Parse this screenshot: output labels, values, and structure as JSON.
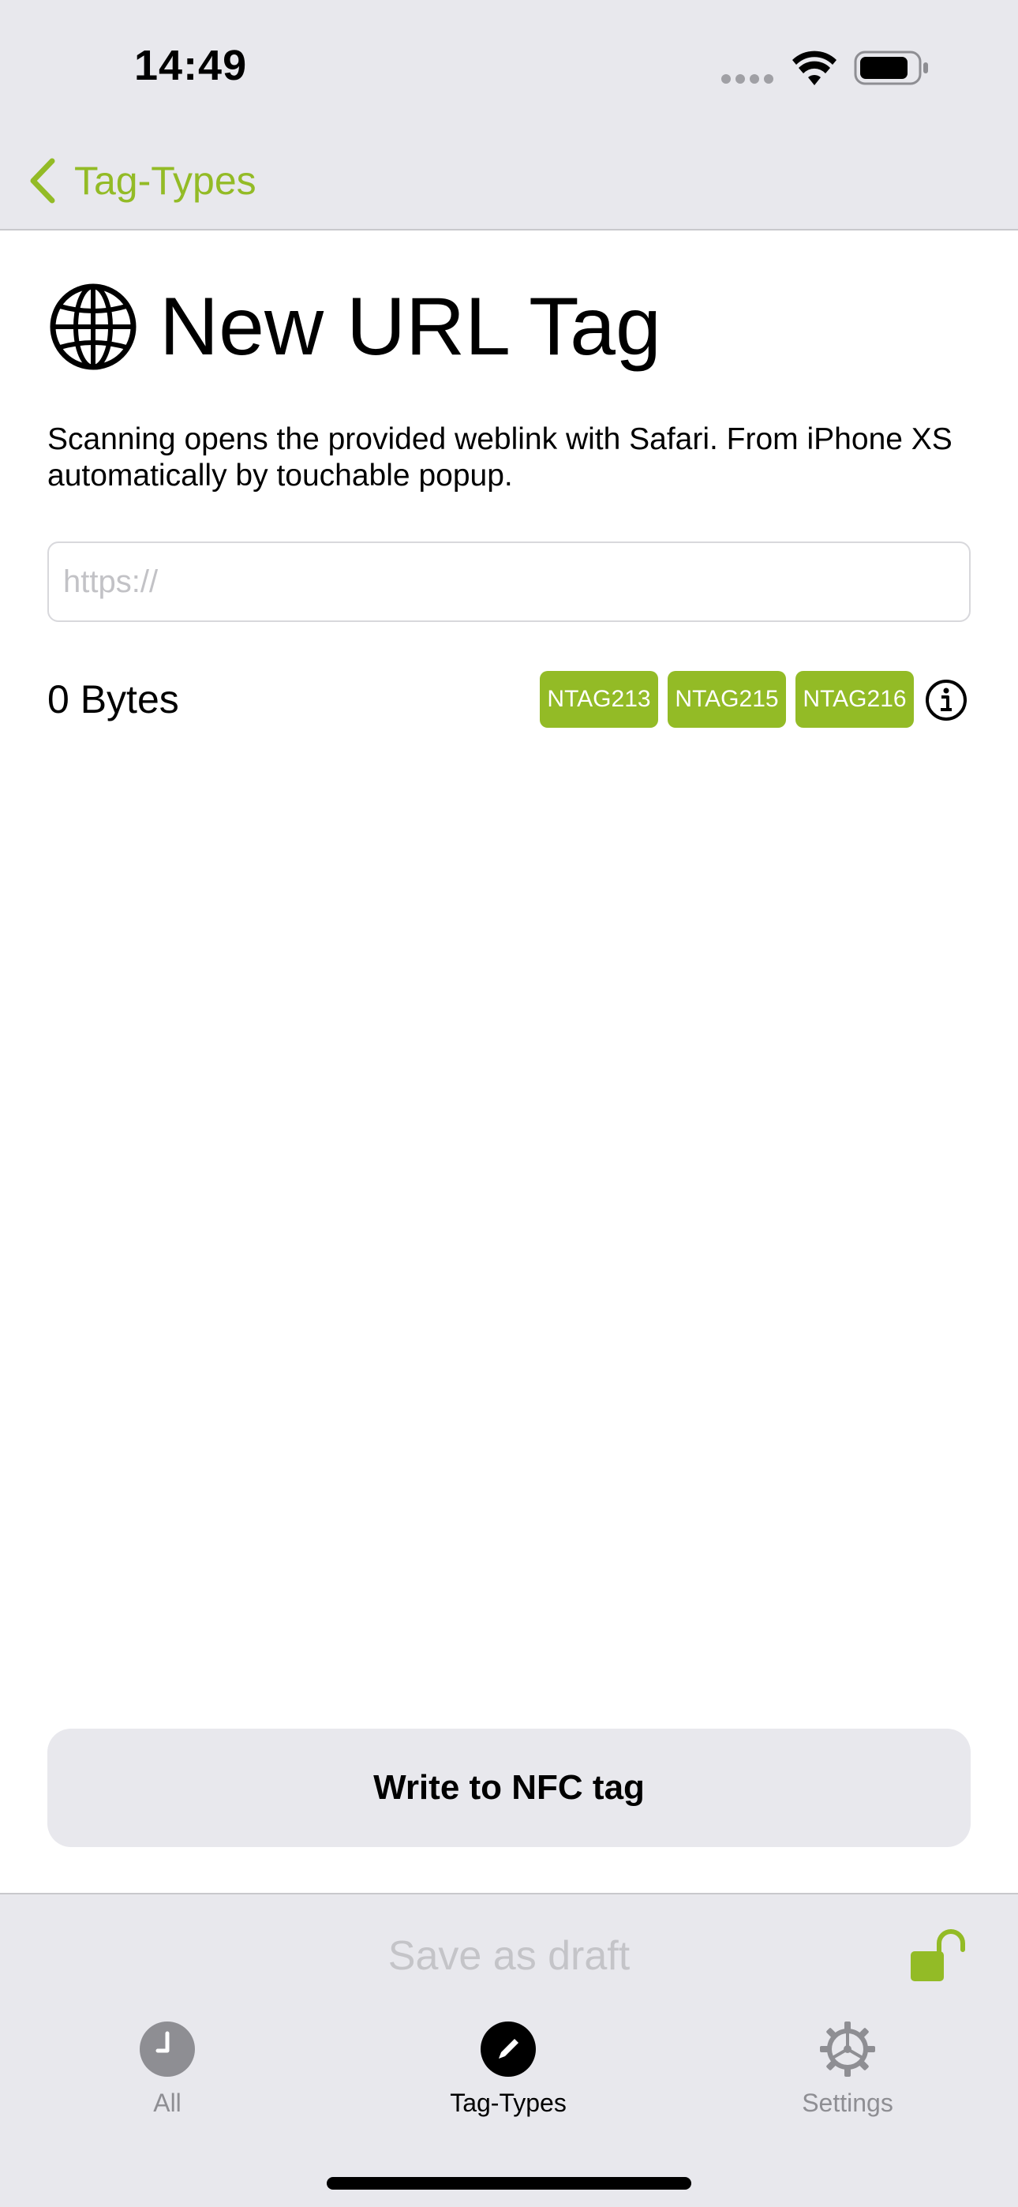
{
  "status_bar": {
    "time": "14:49"
  },
  "nav": {
    "back_label": "Tag-Types"
  },
  "header": {
    "icon": "globe-icon",
    "title": "New URL Tag"
  },
  "description": "Scanning opens the provided weblink with Safari. From iPhone XS automatically by touchable popup.",
  "url_field": {
    "value": "",
    "placeholder": "https://"
  },
  "size": {
    "label": "0 Bytes"
  },
  "compatible_tags": [
    "NTAG213",
    "NTAG215",
    "NTAG216"
  ],
  "write_button": {
    "label": "Write to NFC tag"
  },
  "draft": {
    "label": "Save as draft"
  },
  "tabs": [
    {
      "label": "All",
      "icon": "clock-icon",
      "active": false
    },
    {
      "label": "Tag-Types",
      "icon": "pencil-icon",
      "active": true
    },
    {
      "label": "Settings",
      "icon": "gear-icon",
      "active": false
    }
  ],
  "colors": {
    "accent": "#93bb26",
    "bar_background": "#e8e8ed",
    "inactive": "#8e8e93"
  }
}
